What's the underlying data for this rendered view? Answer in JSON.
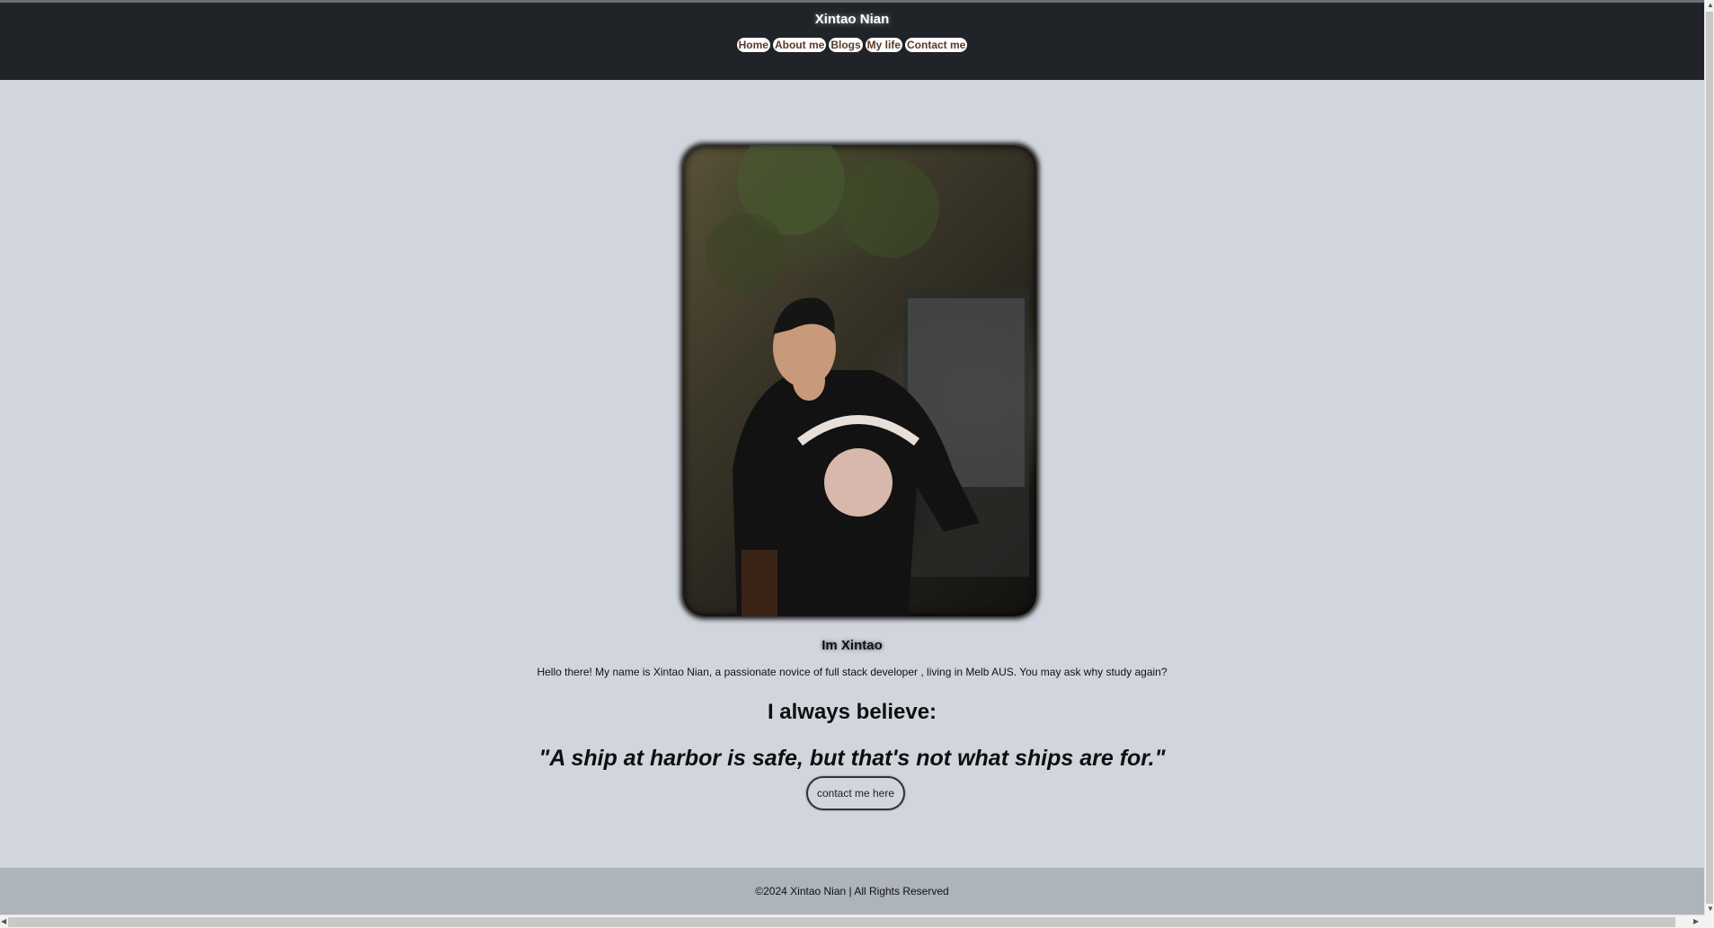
{
  "header": {
    "site_title": "Xintao Nian",
    "nav": [
      {
        "label": "Home"
      },
      {
        "label": "About me"
      },
      {
        "label": "Blogs"
      },
      {
        "label": "My life"
      },
      {
        "label": "Contact me"
      }
    ]
  },
  "main": {
    "photo_alt": "portrait photo",
    "intro_heading": "Im Xintao",
    "bio": "Hello there! My name is Xintao Nian, a passionate novice of full stack developer , living in Melb AUS. You may ask why study again?",
    "believe_heading": "I always believe:",
    "quote": "\"A ship at harbor is safe, but that's not what ships are for.\"",
    "contact_button": "contact me here"
  },
  "footer": {
    "text": "©2024 Xintao Nian | All Rights Reserved"
  },
  "colors": {
    "header_bg": "#202327",
    "page_bg": "#d1d5dd",
    "footer_bg": "#aeb4bb",
    "nav_text": "#5a3a2a"
  }
}
